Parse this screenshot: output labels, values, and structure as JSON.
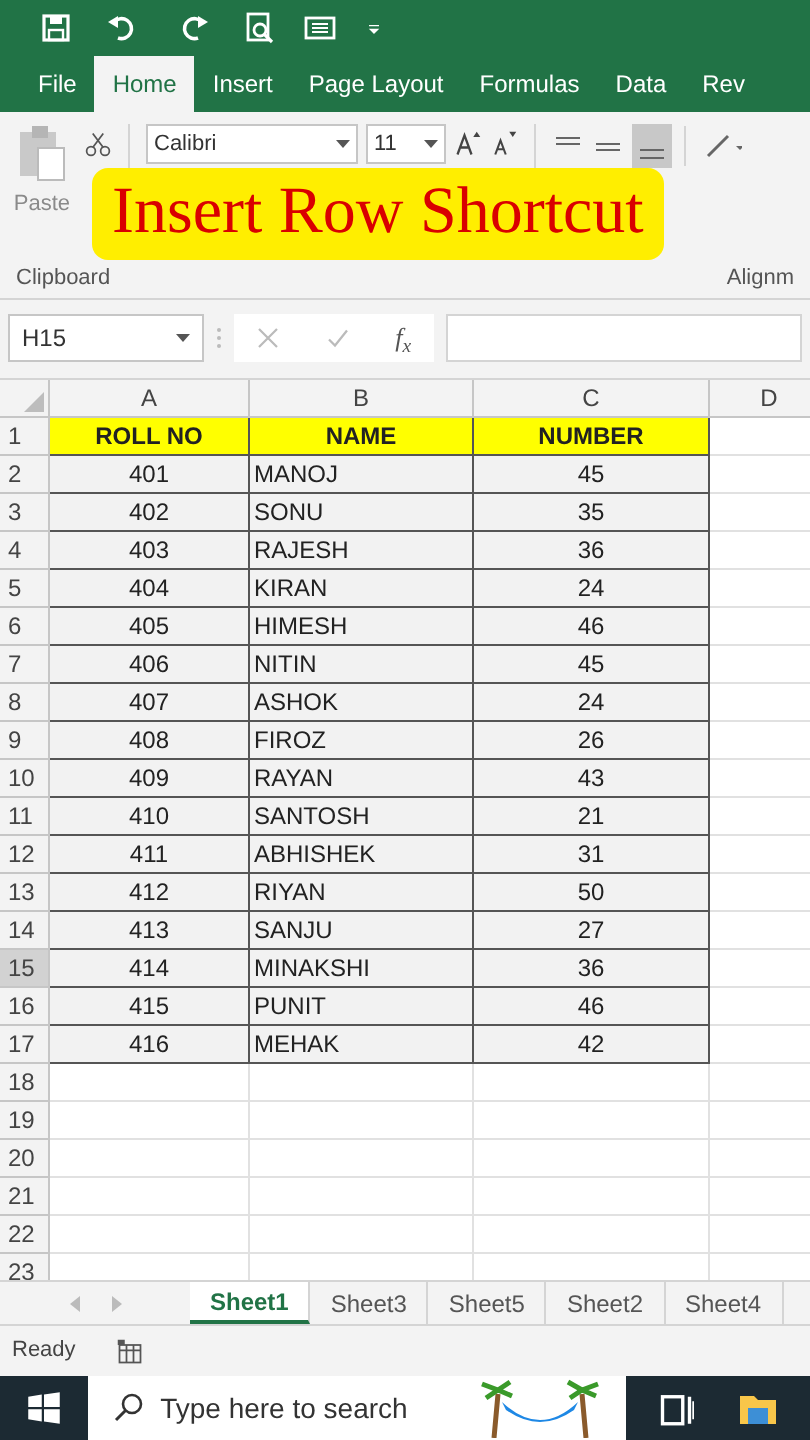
{
  "ribbon_tabs": [
    {
      "label": "File",
      "selected": false
    },
    {
      "label": "Home",
      "selected": true
    },
    {
      "label": "Insert",
      "selected": false
    },
    {
      "label": "Page Layout",
      "selected": false
    },
    {
      "label": "Formulas",
      "selected": false
    },
    {
      "label": "Data",
      "selected": false
    },
    {
      "label": "Rev",
      "selected": false
    }
  ],
  "ribbon": {
    "paste_label": "Paste",
    "font_name": "Calibri",
    "font_size": "11",
    "group_labels": [
      "Clipboard",
      "Alignm"
    ]
  },
  "banner": "Insert Row Shortcut",
  "name_box": "H15",
  "fx_label": "f$_{x}$",
  "columns": [
    "A",
    "B",
    "C",
    "D"
  ],
  "rows": [
    {
      "number": "1",
      "kind": "header",
      "selected": false,
      "cells": [
        "ROLL NO",
        "NAME",
        "NUMBER"
      ]
    },
    {
      "number": "2",
      "kind": "data",
      "selected": false,
      "cells": [
        "401",
        "MANOJ",
        "45"
      ]
    },
    {
      "number": "3",
      "kind": "data",
      "selected": false,
      "cells": [
        "402",
        "SONU",
        "35"
      ]
    },
    {
      "number": "4",
      "kind": "data",
      "selected": false,
      "cells": [
        "403",
        "RAJESH",
        "36"
      ]
    },
    {
      "number": "5",
      "kind": "data",
      "selected": false,
      "cells": [
        "404",
        "KIRAN",
        "24"
      ]
    },
    {
      "number": "6",
      "kind": "data",
      "selected": false,
      "cells": [
        "405",
        "HIMESH",
        "46"
      ]
    },
    {
      "number": "7",
      "kind": "data",
      "selected": false,
      "cells": [
        "406",
        "NITIN",
        "45"
      ]
    },
    {
      "number": "8",
      "kind": "data",
      "selected": false,
      "cells": [
        "407",
        "ASHOK",
        "24"
      ]
    },
    {
      "number": "9",
      "kind": "data",
      "selected": false,
      "cells": [
        "408",
        "FIROZ",
        "26"
      ]
    },
    {
      "number": "10",
      "kind": "data",
      "selected": false,
      "cells": [
        "409",
        "RAYAN",
        "43"
      ]
    },
    {
      "number": "11",
      "kind": "data",
      "selected": false,
      "cells": [
        "410",
        "SANTOSH",
        "21"
      ]
    },
    {
      "number": "12",
      "kind": "data",
      "selected": false,
      "cells": [
        "411",
        "ABHISHEK",
        "31"
      ]
    },
    {
      "number": "13",
      "kind": "data",
      "selected": false,
      "cells": [
        "412",
        "RIYAN",
        "50"
      ]
    },
    {
      "number": "14",
      "kind": "data",
      "selected": false,
      "cells": [
        "413",
        "SANJU",
        "27"
      ]
    },
    {
      "number": "15",
      "kind": "data",
      "selected": true,
      "cells": [
        "414",
        "MINAKSHI",
        "36"
      ]
    },
    {
      "number": "16",
      "kind": "data",
      "selected": false,
      "cells": [
        "415",
        "PUNIT",
        "46"
      ]
    },
    {
      "number": "17",
      "kind": "data",
      "selected": false,
      "cells": [
        "416",
        "MEHAK",
        "42"
      ]
    },
    {
      "number": "18",
      "kind": "empty",
      "selected": false
    },
    {
      "number": "19",
      "kind": "empty",
      "selected": false
    },
    {
      "number": "20",
      "kind": "empty",
      "selected": false
    },
    {
      "number": "21",
      "kind": "empty",
      "selected": false
    },
    {
      "number": "22",
      "kind": "empty",
      "selected": false
    },
    {
      "number": "23",
      "kind": "empty",
      "selected": false
    }
  ],
  "sheet_tabs": [
    {
      "label": "Sheet1",
      "selected": true
    },
    {
      "label": "Sheet3",
      "selected": false
    },
    {
      "label": "Sheet5",
      "selected": false
    },
    {
      "label": "Sheet2",
      "selected": false
    },
    {
      "label": "Sheet4",
      "selected": false
    }
  ],
  "status": "Ready",
  "taskbar": {
    "search_placeholder": "Type here to search"
  }
}
